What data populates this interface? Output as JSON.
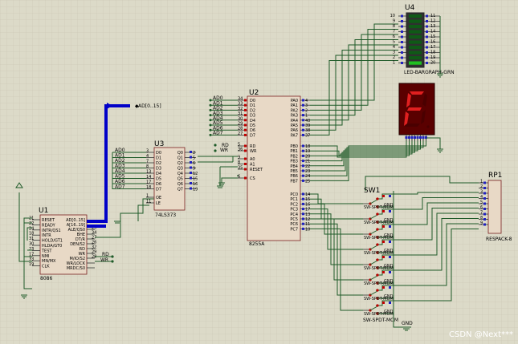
{
  "components": {
    "u1": {
      "ref": "U1",
      "part": "8086",
      "left_pins": [
        "RESET",
        "READY",
        "INTR/QS1",
        "INTR",
        "HOLD/GT1",
        "HLDA/GT0",
        "TEST",
        "NMI",
        "MN/MX",
        "CLK"
      ],
      "left_nums": [
        "21",
        "22",
        "24",
        "18",
        "31",
        "30",
        "23",
        "17",
        "33",
        "19"
      ],
      "right_pins": [
        "AD[0..15]",
        "A[16..19]",
        "ALE/QS0",
        "BHE",
        "DT/R",
        "DEN/S2",
        "RD",
        "WR",
        "M/IO/S2",
        "WR/LOCK",
        "MRDC/S0"
      ],
      "right_nums": [
        "25",
        "34",
        "27",
        "26",
        "32",
        "29",
        "28"
      ]
    },
    "u2": {
      "ref": "U2",
      "part": "8255A",
      "left_pins": [
        "D0",
        "D1",
        "D2",
        "D3",
        "D4",
        "D5",
        "D6",
        "D7",
        "RD",
        "WR",
        "A0",
        "A1",
        "RESET",
        "CS"
      ],
      "left_nums": [
        "34",
        "33",
        "32",
        "31",
        "30",
        "29",
        "28",
        "27",
        "5",
        "36",
        "9",
        "8",
        "35",
        "6"
      ],
      "right_pins": [
        "PA0",
        "PA1",
        "PA2",
        "PA3",
        "PA4",
        "PA5",
        "PA6",
        "PA7",
        "PB0",
        "PB1",
        "PB2",
        "PB3",
        "PB4",
        "PB5",
        "PB6",
        "PB7",
        "PC0",
        "PC1",
        "PC2",
        "PC3",
        "PC4",
        "PC5",
        "PC6",
        "PC7"
      ],
      "right_nums": [
        "4",
        "3",
        "2",
        "1",
        "40",
        "39",
        "38",
        "37",
        "18",
        "19",
        "20",
        "21",
        "22",
        "23",
        "24",
        "25",
        "14",
        "15",
        "16",
        "17",
        "13",
        "12",
        "11",
        "10"
      ],
      "net_labels": [
        "AD0",
        "AD1",
        "AD2",
        "AD3",
        "AD4",
        "AD5",
        "AD6",
        "AD7"
      ],
      "ctl_labels": [
        "RD",
        "WR"
      ]
    },
    "u3": {
      "ref": "U3",
      "part": "74LS373",
      "left_pins": [
        "D0",
        "D1",
        "D2",
        "D3",
        "D4",
        "D5",
        "D6",
        "D7",
        "OE",
        "LE"
      ],
      "left_nums": [
        "3",
        "4",
        "7",
        "8",
        "13",
        "14",
        "17",
        "18",
        "1",
        "11"
      ],
      "right_pins": [
        "Q0",
        "Q1",
        "Q2",
        "Q3",
        "Q4",
        "Q5",
        "Q6",
        "Q7"
      ],
      "right_nums": [
        "2",
        "5",
        "6",
        "9",
        "12",
        "15",
        "16",
        "19"
      ],
      "net_labels": [
        "AD0",
        "AD1",
        "AD2",
        "AD3",
        "AD4",
        "AD5",
        "AD6",
        "AD7"
      ]
    },
    "u4": {
      "ref": "U4",
      "part": "LED-BARGRAPH-GRN",
      "left_nums": [
        "10",
        "9",
        "8",
        "7",
        "6",
        "5",
        "4",
        "3",
        "2",
        "1"
      ],
      "right_nums": [
        "11",
        "12",
        "13",
        "14",
        "15",
        "16",
        "17",
        "18",
        "19",
        "20"
      ]
    },
    "rp1": {
      "ref": "RP1",
      "part": "RESPACK-8",
      "nums": [
        "1",
        "2",
        "3",
        "4",
        "5",
        "6",
        "7",
        "8",
        "9"
      ]
    },
    "sw1": {
      "ref": "SW1",
      "part": "SW-SPDT-MOM",
      "gnd_label": "GND",
      "count": 8
    },
    "seg": {
      "digit": "F"
    }
  },
  "bus": {
    "label1": "AD[0..15]"
  },
  "gnd": "GND",
  "watermark": "CSDN @Next***",
  "colors": {
    "background": "#dcdac8",
    "wire": "#1e5a28",
    "bus": "#0000c8",
    "component_fill": "#e8d9c6",
    "component_border": "#7a2020",
    "segment_on": "#e02020",
    "segment_off": "#4a0000",
    "led_on": "#20c020",
    "led_off": "#0f5a16"
  }
}
